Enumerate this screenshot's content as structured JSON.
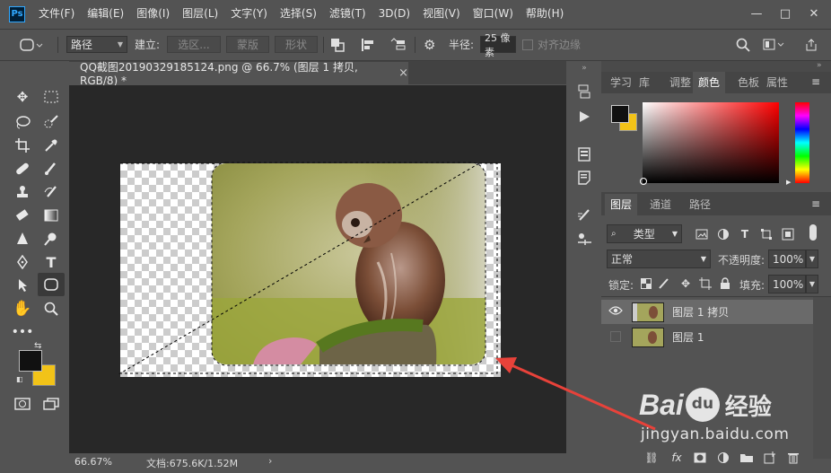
{
  "app": {
    "logo": "Ps"
  },
  "menu": [
    "文件(F)",
    "编辑(E)",
    "图像(I)",
    "图层(L)",
    "文字(Y)",
    "选择(S)",
    "滤镜(T)",
    "3D(D)",
    "视图(V)",
    "窗口(W)",
    "帮助(H)"
  ],
  "window_controls": {
    "minimize": "—",
    "restore": "□",
    "close": "✕"
  },
  "options": {
    "mode": "路径",
    "create_label": "建立:",
    "selection_btn": "选区...",
    "mask_btn": "蒙版",
    "shape_btn": "形状",
    "radius_label": "半径:",
    "radius_value": "25 像素",
    "align_edges": "对齐边缘"
  },
  "document": {
    "tab_title": "QQ截图20190329185124.png @ 66.7% (图层 1 拷贝, RGB/8) *",
    "close": "×"
  },
  "status": {
    "zoom": "66.67%",
    "doc_info": "文档:675.6K/1.52M",
    "arrow": "›"
  },
  "color_panel": {
    "tabs": [
      "学习",
      "库",
      "调整",
      "颜色",
      "色板",
      "属性"
    ],
    "active_tab": "颜色",
    "foreground": "#111111",
    "background": "#f2c318"
  },
  "layers_panel": {
    "tabs": [
      "图层",
      "通道",
      "路径"
    ],
    "active_tab": "图层",
    "filter_kind": "类型",
    "blend_mode": "正常",
    "opacity_label": "不透明度:",
    "opacity_value": "100%",
    "lock_label": "锁定:",
    "fill_label": "填充:",
    "fill_value": "100%",
    "layers": [
      {
        "name": "图层 1 拷贝",
        "visible": true,
        "selected": true
      },
      {
        "name": "图层 1",
        "visible": false,
        "selected": false
      }
    ]
  },
  "watermark": {
    "brand": "Bai",
    "paw_text": "du",
    "brand_cn": "经验",
    "url": "jingyan.baidu.com"
  },
  "colors": {
    "accent_arrow": "#e8423a",
    "ps_blue": "#31a8ff",
    "canvas_bg": "#282828"
  }
}
